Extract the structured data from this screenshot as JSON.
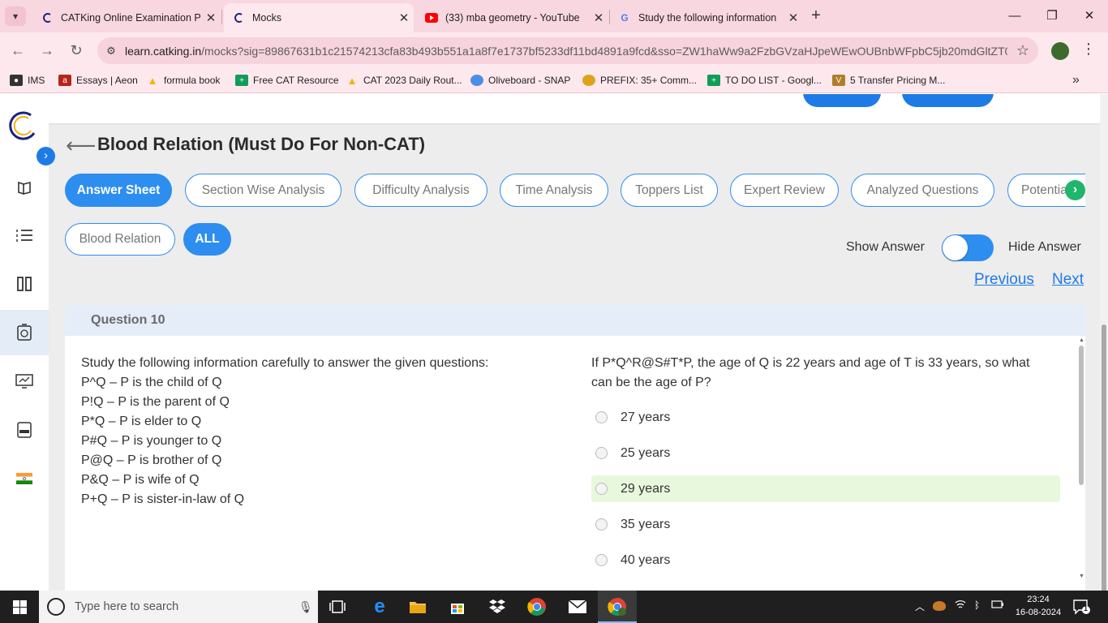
{
  "browser": {
    "tabs": [
      {
        "title": "CATKing Online Examination Pl",
        "active": false,
        "favicon": "catking-icon"
      },
      {
        "title": "Mocks",
        "active": true,
        "favicon": "catking-icon"
      },
      {
        "title": "(33) mba geometry - YouTube",
        "active": false,
        "favicon": "youtube-icon"
      },
      {
        "title": "Study the following information",
        "active": false,
        "favicon": "google-icon"
      }
    ],
    "new_tab": "+",
    "url_host": "learn.catking.in",
    "url_path": "/mocks?sig=89867631b1c21574213cfa83b493b551a1a8f7e1737bf5233df11bd4891a9fcd&sso=ZW1haWw9a2FzbGVzaHJpeWEwOUBnbWFpbC5jb20mdGltZT0...",
    "bookmarks": [
      {
        "label": "IMS",
        "color": "#333333"
      },
      {
        "label": "Essays | Aeon",
        "color": "#b4261a"
      },
      {
        "label": "formula book",
        "color": "#f4b400"
      },
      {
        "label": "Free CAT Resource",
        "color": "#0f9d58"
      },
      {
        "label": "CAT 2023 Daily Rout...",
        "color": "#f4b400"
      },
      {
        "label": "Oliveboard - SNAP",
        "color": "#4a90e2"
      },
      {
        "label": "PREFIX: 35+ Comm...",
        "color": "#e0a21b"
      },
      {
        "label": "TO DO LIST - Googl...",
        "color": "#0f9d58"
      },
      {
        "label": "5 Transfer Pricing M...",
        "color": "#b07d2a"
      }
    ],
    "bookmarks_more": "»"
  },
  "page": {
    "title": "Blood Relation (Must Do For Non-CAT)",
    "tabs": [
      {
        "label": "Answer Sheet",
        "active": true
      },
      {
        "label": "Section Wise Analysis",
        "active": false
      },
      {
        "label": "Difficulty Analysis",
        "active": false
      },
      {
        "label": "Time Analysis",
        "active": false
      },
      {
        "label": "Toppers List",
        "active": false
      },
      {
        "label": "Expert Review",
        "active": false
      },
      {
        "label": "Analyzed Questions",
        "active": false
      },
      {
        "label": "Potentia",
        "active": false
      }
    ],
    "filters": [
      {
        "label": "Blood Relation",
        "active": false
      },
      {
        "label": "ALL",
        "active": true
      }
    ],
    "show_answer_label": "Show Answer",
    "hide_answer_label": "Hide Answer",
    "previous_label": "Previous",
    "next_label": "Next",
    "question": {
      "number_label": "Question 10",
      "passage": [
        "Study the following information carefully to answer the given questions:",
        "P^Q – P is the child of Q",
        "P!Q – P is the parent of Q",
        "P*Q – P is elder to Q",
        "P#Q – P is younger to Q",
        "P@Q – P is brother of Q",
        "P&Q – P is wife of Q",
        "P+Q – P is sister-in-law of Q"
      ],
      "text": "If P*Q^R@S#T*P, the age of Q is 22 years and age of T is 33 years, so what can be the age of P?",
      "options": [
        {
          "label": "27 years",
          "correct": false
        },
        {
          "label": "25 years",
          "correct": false
        },
        {
          "label": "29 years",
          "correct": true
        },
        {
          "label": "35 years",
          "correct": false
        },
        {
          "label": "40 years",
          "correct": false
        }
      ]
    }
  },
  "taskbar": {
    "search_placeholder": "Type here to search",
    "time": "23:24",
    "date": "16-08-2024",
    "notification_count": "1"
  }
}
